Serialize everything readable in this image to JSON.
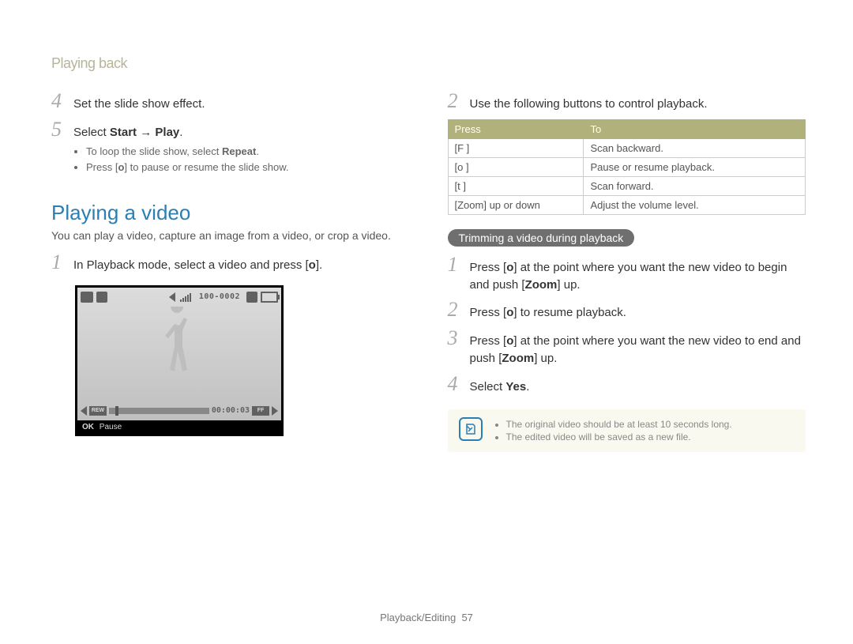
{
  "header": {
    "crumb": "Playing back"
  },
  "left": {
    "steps_a": [
      {
        "num": "4",
        "text": "Set the slide show effect."
      },
      {
        "num": "5",
        "text_pre": "Select ",
        "bold1": "Start",
        "arrow": " → ",
        "bold2": "Play",
        "text_post": ".",
        "sub": [
          {
            "pre": "To loop the slide show, select ",
            "bold": "Repeat",
            "post": "."
          },
          {
            "pre": "Press [",
            "key": "o",
            "post": "] to pause or resume the slide show."
          }
        ]
      }
    ],
    "section_title": "Playing a video",
    "section_intro": "You can play a video, capture an image from a video, or crop a video.",
    "steps_b": [
      {
        "num": "1",
        "text_pre": "In Playback mode, select a video and press [",
        "key": "o",
        "text_post": "]."
      }
    ],
    "camera": {
      "file_counter": "100-0002",
      "timecode": "00:00:03",
      "rew": "REW",
      "ff": "FF",
      "ok": "OK",
      "ok_label": "Pause"
    }
  },
  "right": {
    "steps_a": [
      {
        "num": "2",
        "text": "Use the following buttons to control playback."
      }
    ],
    "table": {
      "head": [
        "Press",
        "To"
      ],
      "rows": [
        [
          "[F   ]",
          "Scan backward."
        ],
        [
          "[o   ]",
          "Pause or resume playback."
        ],
        [
          "[t   ]",
          "Scan forward."
        ],
        [
          "[Zoom] up or down",
          "Adjust the volume level."
        ]
      ]
    },
    "pill": "Trimming a video during playback",
    "steps_b": [
      {
        "num": "1",
        "pre": "Press [",
        "key": "o",
        "mid": "] at the point where you want the new video to begin and push [",
        "bold": "Zoom",
        "post": "] up."
      },
      {
        "num": "2",
        "pre": "Press [",
        "key": "o",
        "post": "] to resume playback."
      },
      {
        "num": "3",
        "pre": "Press [",
        "key": "o",
        "mid": "] at the point where you want the new video to end and push [",
        "bold": "Zoom",
        "post": "] up."
      },
      {
        "num": "4",
        "pre": "Select ",
        "bold": "Yes",
        "post": "."
      }
    ],
    "notes": [
      "The original video should be at least 10 seconds long.",
      "The edited video will be saved as a new file."
    ]
  },
  "footer": {
    "section": "Playback/Editing",
    "page": "57"
  }
}
